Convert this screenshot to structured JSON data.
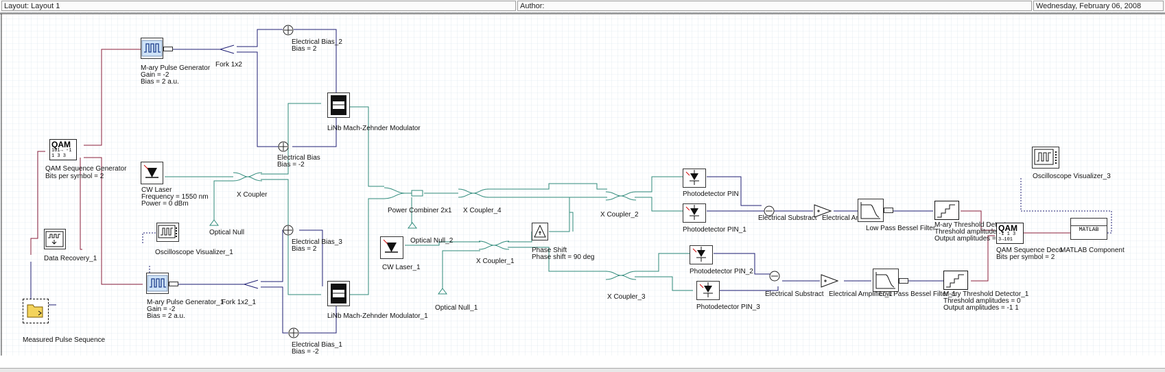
{
  "header": {
    "layout": "Layout: Layout 1",
    "author": "Author:",
    "date": "Wednesday, February 06, 2008"
  },
  "labels": {
    "qam_gen": "QAM Sequence Generator",
    "qam_gen_param": "Bits per symbol = 2",
    "mpg": "M-ary Pulse Generator",
    "mpg_gain": "Gain = -2",
    "mpg_bias": "Bias = 2  a.u.",
    "fork": "Fork 1x2",
    "eb2": "Electrical Bias_2",
    "eb2_bias": "Bias = 2",
    "mzm": "LiNb Mach-Zehnder Modulator",
    "eb": "Electrical Bias",
    "eb_bias": "Bias = -2",
    "cw": "CW Laser",
    "cw_freq": "Frequency = 1550  nm",
    "cw_power": "Power = 0  dBm",
    "xc": "X Coupler",
    "onull": "Optical Null",
    "osc1": "Oscilloscope Visualizer_1",
    "dr": "Data Recovery_1",
    "eb3": "Electrical Bias_3",
    "eb3_bias": "Bias = 2",
    "mpg1": "M-ary Pulse Generator_1",
    "mpg1_gain": "Gain = -2",
    "mpg1_bias": "Bias = 2  a.u.",
    "fork1": "Fork 1x2_1",
    "mzm1": "LiNb Mach-Zehnder Modulator_1",
    "eb1": "Electrical Bias_1",
    "eb1_bias": "Bias = -2",
    "mps": "Measured Pulse Sequence",
    "pc": "Power Combiner 2x1",
    "xc4": "X Coupler_4",
    "cw1": "CW Laser_1",
    "onull2": "Optical Null_2",
    "xc1": "X Coupler_1",
    "onull1": "Optical Null_1",
    "ps": "Phase Shift",
    "ps_param": "Phase shift = 90  deg",
    "xc2": "X Coupler_2",
    "xc3": "X Coupler_3",
    "pd": "Photodetector PIN",
    "pd1": "Photodetector PIN_1",
    "pd2": "Photodetector PIN_2",
    "pd3": "Photodetector PIN_3",
    "es": "Electrical Substract",
    "ea": "Electrical Amplifier",
    "lp": "Low Pass Bessel Filter",
    "es1": "Electrical Substract",
    "ea1": "Electrical Amplifier_1",
    "lp1": "Low Pass Bessel Filter_1",
    "mtd": "M-ary Threshold Detector",
    "mtd_thr": "Threshold amplitudes = 0",
    "mtd_out": "Output amplitudes = -1 1",
    "mtd1": "M-ary Threshold Detector_1",
    "mtd1_thr": "Threshold amplitudes = 0",
    "mtd1_out": "Output amplitudes = -1 1",
    "osc3": "Oscilloscope Visualizer_3",
    "qam_dec": "QAM Sequence Deco",
    "qam_dec_param": "Bits per symbol = 2",
    "matlab": "MATLAB Component",
    "qam_big": "QAM",
    "qam_small_gen": "101→ -1 1 3 3",
    "qam_small_dec": "-1 1 3 3→101",
    "matlab_text": "MATLAB",
    "plus": "+",
    "minus": "−"
  },
  "colors": {
    "electrical_wire": "#1d1d73",
    "optical_wire": "#2e8a7a",
    "red_wire": "#8a1c3a",
    "grid": "#d6dfea"
  }
}
